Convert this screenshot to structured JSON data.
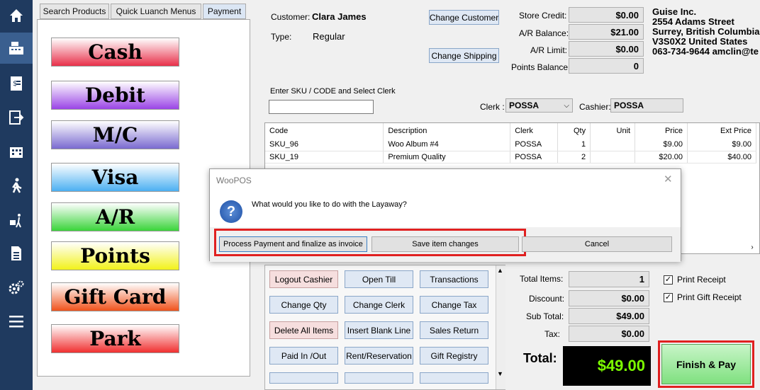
{
  "sidebar": {
    "icons": [
      "home-icon",
      "cash-register-icon",
      "receipt-icon",
      "sign-out-icon",
      "building-icon",
      "walking-customer-icon",
      "delivery-icon",
      "report-icon",
      "settings-icon",
      "menu-icon"
    ]
  },
  "tabs": [
    "Search Products",
    "Quick Luanch Menus",
    "Payment"
  ],
  "payment_buttons": [
    {
      "label": "Cash",
      "color": "#e8304a"
    },
    {
      "label": "Debit",
      "color": "#9a45e6"
    },
    {
      "label": "M/C",
      "color": "#7a6ad0"
    },
    {
      "label": "Visa",
      "color": "#4cb0f2"
    },
    {
      "label": "A/R",
      "color": "#3ad43a"
    },
    {
      "label": "Points",
      "color": "#f2f21a"
    },
    {
      "label": "Gift Card",
      "color": "#f0531c"
    },
    {
      "label": "Park",
      "color": "#f03030"
    }
  ],
  "customer": {
    "label": "Customer:",
    "name": "Clara James",
    "type_label": "Type:",
    "type": "Regular",
    "change_customer": "Change Customer",
    "change_shipping": "Change Shipping"
  },
  "balances": {
    "store_credit_label": "Store Credit:",
    "store_credit": "$0.00",
    "ar_balance_label": "A/R Balance:",
    "ar_balance": "$21.00",
    "ar_limit_label": "A/R Limit:",
    "ar_limit": "$0.00",
    "points_label": "Points Balance:",
    "points": "0"
  },
  "company": {
    "name": "Guise Inc.",
    "street": "2554 Adams Street",
    "city": "Surrey, British Columbia",
    "postal": "V3S0X2 United States",
    "contact": "063-734-9644 amclin@te"
  },
  "sku": {
    "label": "Enter SKU / CODE and Select Clerk",
    "value": "",
    "clerk_label": "Clerk :",
    "clerk": "POSSA",
    "cashier_label": "Cashier:",
    "cashier": "POSSA"
  },
  "grid": {
    "headers": [
      "Code",
      "Description",
      "Clerk",
      "Qty",
      "Unit",
      "Price",
      "Ext Price"
    ],
    "rows": [
      [
        "SKU_96",
        "Woo Album #4",
        "POSSA",
        "1",
        "",
        "$9.00",
        "$9.00"
      ],
      [
        "SKU_19",
        "Premium Quality",
        "POSSA",
        "2",
        "",
        "$20.00",
        "$40.00"
      ]
    ]
  },
  "dialog": {
    "title": "WooPOS",
    "message": "What would you like to do with the Layaway?",
    "btn_process": "Process Payment and finalize as invoice",
    "btn_save": "Save item changes",
    "btn_cancel": "Cancel"
  },
  "actions": [
    {
      "label": "Logout Cashier",
      "style": "red"
    },
    {
      "label": "Open Till",
      "style": "blue"
    },
    {
      "label": "Transactions",
      "style": "blue"
    },
    {
      "label": "Change Qty",
      "style": "blue"
    },
    {
      "label": "Change Clerk",
      "style": "blue"
    },
    {
      "label": "Change Tax",
      "style": "blue"
    },
    {
      "label": "Delete All Items",
      "style": "red"
    },
    {
      "label": "Insert Blank Line",
      "style": "blue"
    },
    {
      "label": "Sales Return",
      "style": "blue"
    },
    {
      "label": "Paid In /Out",
      "style": "blue"
    },
    {
      "label": "Rent/Reservation",
      "style": "blue"
    },
    {
      "label": "Gift Registry",
      "style": "blue"
    }
  ],
  "totals": {
    "items_label": "Total Items:",
    "items": "1",
    "discount_label": "Discount:",
    "discount": "$0.00",
    "subtotal_label": "Sub Total:",
    "subtotal": "$49.00",
    "tax_label": "Tax:",
    "tax": "$0.00",
    "total_label": "Total:",
    "total": "$49.00",
    "finish": "Finish & Pay"
  },
  "receipts": {
    "print_receipt": "Print Receipt",
    "print_gift": "Print Gift Receipt"
  }
}
